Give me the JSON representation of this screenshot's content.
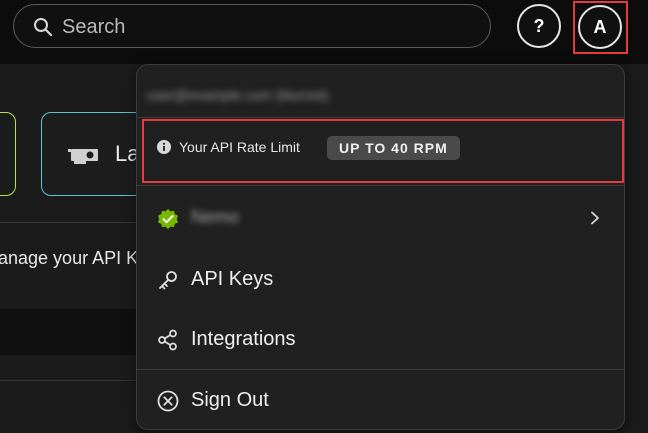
{
  "search": {
    "placeholder": "Search"
  },
  "header": {
    "help_label": "?",
    "avatar_initial": "A"
  },
  "background": {
    "card_label": "La",
    "description": "anage your API K"
  },
  "menu": {
    "email": "user@example.com (blurred)",
    "rate_limit_label": "Your API Rate Limit",
    "rate_limit_badge": "UP TO 40 RPM",
    "org_name": "Nemo",
    "api_keys_label": "API Keys",
    "integrations_label": "Integrations",
    "sign_out_label": "Sign Out"
  },
  "colors": {
    "highlight": "#e53a3f",
    "verified_green": "#76b900",
    "card_green": "#b8e04a",
    "card_cyan": "#5ec3d8"
  }
}
